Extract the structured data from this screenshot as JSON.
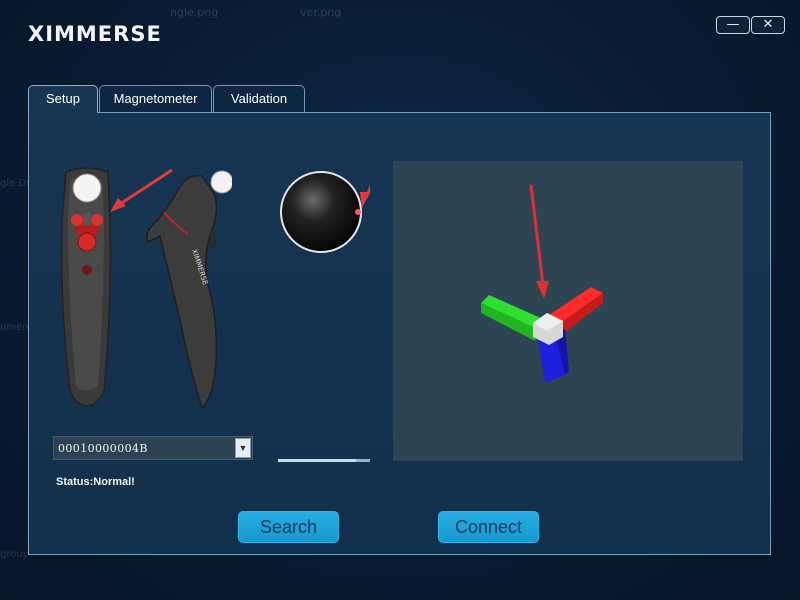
{
  "app": {
    "logo": "XIMMERSE"
  },
  "window_controls": {
    "minimize": "—",
    "close": "✕"
  },
  "tabs": [
    {
      "label": "Setup",
      "active": true
    },
    {
      "label": "Magnetometer",
      "active": false
    },
    {
      "label": "Validation",
      "active": false
    }
  ],
  "device": {
    "selected": "00010000004B",
    "dropdown_icon": "chevron-down"
  },
  "status": "Status:Normal!",
  "buttons": {
    "search": "Search",
    "connect": "Connect"
  },
  "progress": {
    "fraction": 0.85
  },
  "colors": {
    "accent": "#1ba4db",
    "axis_x": "#e41d1d",
    "axis_y": "#2ed52e",
    "axis_z": "#1f1fd6",
    "arrow": "#e23a3a"
  }
}
